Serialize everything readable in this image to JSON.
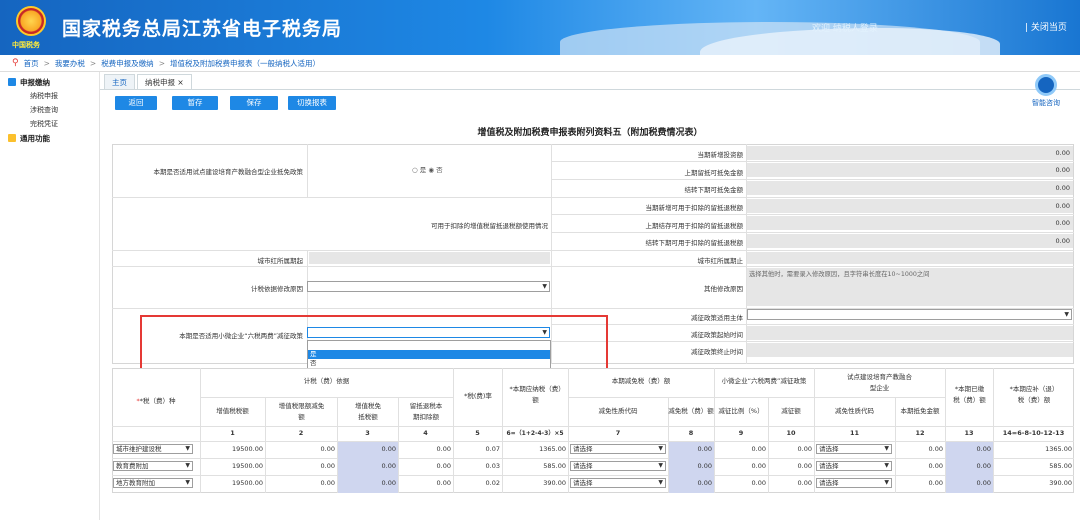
{
  "header": {
    "site_title": "国家税务总局江苏省电子税务局",
    "emblem_text": "中国税务",
    "welcome": "欢迎 纳税人登录",
    "close_page": "| 关闭当页"
  },
  "breadcrumb": [
    "首页",
    "我要办税",
    "税费申报及缴纳",
    "增值税及附加税费申报表（一般纳税人适用）"
  ],
  "sidebar": {
    "group1": "申报缴纳",
    "items": [
      "纳税申报",
      "涉税查询",
      "完税凭证"
    ],
    "group2": "通用功能"
  },
  "tabs": [
    "主页",
    "纳税申报 ×"
  ],
  "toolbar": {
    "back": "返回",
    "temp_save": "暂存",
    "save": "保存",
    "switch": "切换报表"
  },
  "help": {
    "label": "智能咨询"
  },
  "form": {
    "title": "增值税及附加税费申报表附列资料五（附加税费情况表）",
    "q1": "本期是否适用试点建设培育产教融合型企业抵免政策",
    "radio_yes": "是",
    "radio_no": "否",
    "r_labels": [
      "当期新增投资额",
      "上期留抵可抵免金额",
      "结转下期可抵免金额",
      "当期新增可用于扣除的留抵退税额",
      "上期结存可用于扣除的留抵退税额",
      "结转下期可用于扣除的留抵退税额"
    ],
    "r_values": [
      "0.00",
      "0.00",
      "0.00",
      "0.00",
      "0.00",
      "0.00"
    ],
    "q2": "可用于扣除的增值税留抵退税额使用情况",
    "adj_start": "城市红所属期起",
    "adj_end": "城市红所属期止",
    "reason_label": "计税依据修改原因",
    "other_reason": "其他修改原因",
    "other_placeholder": "选择其他时，需要录入修改原因，且字符串长度在10~1000之间",
    "policy_subject": "减征政策适用主体",
    "policy_start": "减征政策起始时间",
    "policy_end": "减征政策终止时间",
    "q3": "本期是否适用小微企业“六税两费”减征政策",
    "dropdown_options": [
      "",
      "是",
      "否"
    ]
  },
  "table": {
    "tax_type": "*税（费）种",
    "basis": "计税（费）依据",
    "basis_cols": [
      "增值税税额",
      "增值税限额减免额",
      "增值税免抵税额",
      "留抵退税本期扣除额"
    ],
    "rate": "*税(费)率",
    "payable": "*本期应纳税（费）额",
    "relief": "本期减免税（费）额",
    "relief_cols": [
      "减免性质代码",
      "减免税（费）额"
    ],
    "small": "小微企业“六税两费”减征政策",
    "small_cols": [
      "减征比例（%）",
      "减征额"
    ],
    "pilot": "试点建设培育产教融合型企业",
    "pilot_cols": [
      "减免性质代码",
      "本期抵免金额"
    ],
    "paid": "*本期已缴税（费）额",
    "due": "*本期应补（退）税（费）额",
    "col_nums": [
      "1",
      "2",
      "3",
      "4",
      "5",
      "6=（1+2-4-3）×5",
      "7",
      "8",
      "9",
      "10",
      "11",
      "12",
      "13",
      "14=6-8-10-12-13"
    ],
    "rows": [
      {
        "name": "城市维护建设税",
        "v1": "19500.00",
        "v2": "0.00",
        "v3": "0.00",
        "v4": "0.00",
        "rate": "0.07",
        "payable": "1365.00",
        "code": "请选择",
        "v8": "0.00",
        "v9": "0.00",
        "v10": "0.00",
        "code2": "请选择",
        "v12": "0.00",
        "v13": "0.00",
        "v14": "1365.00"
      },
      {
        "name": "教育费附加",
        "v1": "19500.00",
        "v2": "0.00",
        "v3": "0.00",
        "v4": "0.00",
        "rate": "0.03",
        "payable": "585.00",
        "code": "请选择",
        "v8": "0.00",
        "v9": "0.00",
        "v10": "0.00",
        "code2": "请选择",
        "v12": "0.00",
        "v13": "0.00",
        "v14": "585.00"
      },
      {
        "name": "地方教育附加",
        "v1": "19500.00",
        "v2": "0.00",
        "v3": "0.00",
        "v4": "0.00",
        "rate": "0.02",
        "payable": "390.00",
        "code": "请选择",
        "v8": "0.00",
        "v9": "0.00",
        "v10": "0.00",
        "code2": "请选择",
        "v12": "0.00",
        "v13": "0.00",
        "v14": "390.00"
      }
    ]
  }
}
